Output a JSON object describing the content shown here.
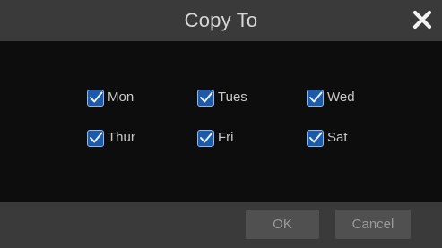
{
  "dialog": {
    "title": "Copy To",
    "close_icon": "close-icon",
    "days": [
      {
        "label": "Mon",
        "checked": true
      },
      {
        "label": "Tues",
        "checked": true
      },
      {
        "label": "Wed",
        "checked": true
      },
      {
        "label": "Thur",
        "checked": true
      },
      {
        "label": "Fri",
        "checked": true
      },
      {
        "label": "Sat",
        "checked": true
      }
    ],
    "buttons": {
      "ok_label": "OK",
      "cancel_label": "Cancel"
    },
    "colors": {
      "titlebar": "#3a3a3a",
      "body": "#0d0d0d",
      "checkbox": "#1d5aa8",
      "button": "#505050",
      "text": "#c9c9c9"
    }
  }
}
